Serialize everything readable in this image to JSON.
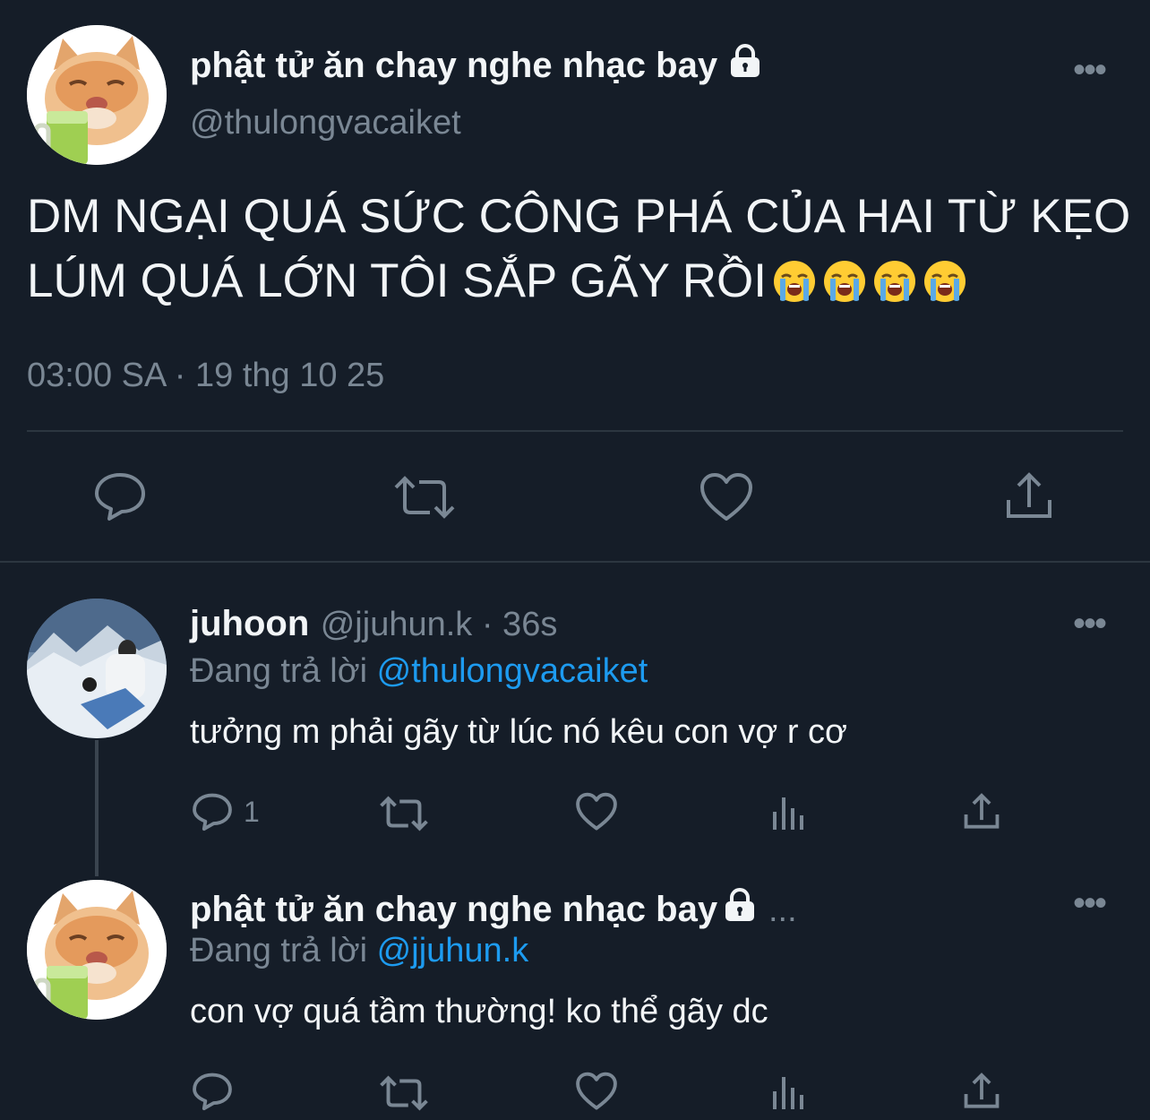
{
  "main_tweet": {
    "display_name": "phật tử ăn chay nghe nhạc bay",
    "handle": "@thulongvacaiket",
    "text_line1": "DM NGẠI QUÁ SỨC CÔNG PHÁ CỦA HAI TỪ KẸO",
    "text_line2": "LÚM QUÁ LỚN TÔI SẮP GÃY RỒI",
    "emojis": [
      "loudly-crying-face",
      "loudly-crying-face",
      "loudly-crying-face",
      "loudly-crying-face"
    ],
    "timestamp": "03:00 SA · 19 thg 10 25"
  },
  "reply1": {
    "display_name": "juhoon",
    "handle_time": "@jjuhun.k · 36s",
    "replying_prefix": "Đang trả lời",
    "replying_to": "@thulongvacaiket",
    "text": "tưởng m phải gãy từ lúc nó kêu con vợ r cơ",
    "reply_count": "1"
  },
  "reply2": {
    "display_name": "phật tử ăn chay nghe nhạc bay",
    "ellipsis": "...",
    "replying_prefix": "Đang trả lời",
    "replying_to": "@jjuhun.k",
    "text": "con vợ quá tầm thường! ko thể gãy dc"
  },
  "more_label": "•••",
  "colors": {
    "background": "#151d28",
    "link": "#1d9bf0",
    "muted": "#7a8794",
    "text": "#f2f5f7"
  }
}
